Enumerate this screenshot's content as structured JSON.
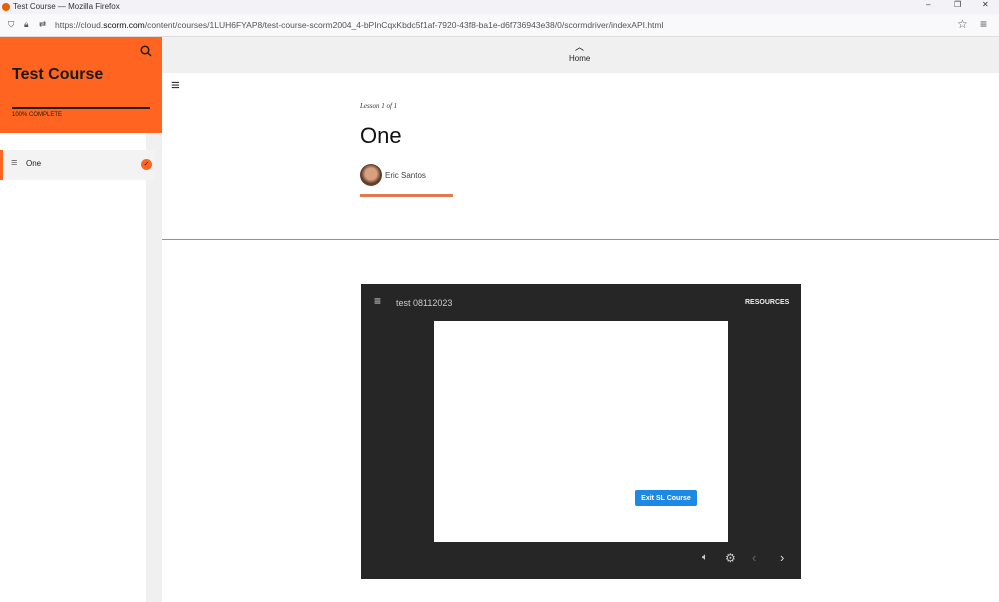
{
  "window": {
    "title": "Test Course — Mozilla Firefox",
    "url_prefix": "https://cloud.",
    "url_domain": "scorm.com",
    "url_rest": "/content/courses/1LUH6FYAP8/test-course-scorm2004_4-bPInCqxKbdc5f1af-7920-43f8-ba1e-d6f736943e38/0/scormdriver/indexAPI.html"
  },
  "sidebar": {
    "course_title": "Test Course",
    "progress_label": "100% COMPLETE",
    "progress": 100,
    "lessons": [
      {
        "label": "One",
        "completed": true
      }
    ]
  },
  "main": {
    "home_label": "Home",
    "lesson_counter": "Lesson 1 of 1",
    "lesson_title": "One",
    "author": "Eric Santos"
  },
  "player": {
    "title": "test 08112023",
    "resources_label": "RESOURCES",
    "exit_button": "Exit SL Course"
  },
  "colors": {
    "accent": "#ff6521",
    "button": "#1e88e5"
  }
}
